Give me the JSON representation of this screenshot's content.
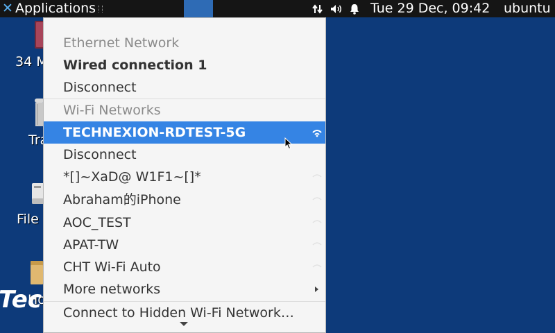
{
  "panel": {
    "applications_label": "Applications",
    "clock": "Tue 29 Dec, 09:42",
    "hostname": "ubuntu",
    "tray_icons": [
      "network-transfer-icon",
      "volume-icon",
      "notification-bell-icon"
    ]
  },
  "desktop": {
    "icons": [
      {
        "label": "34 M",
        "icon": "drive-icon"
      },
      {
        "label": "Tra",
        "icon": "trash-icon"
      },
      {
        "label": "File",
        "icon": "filesystem-icon"
      },
      {
        "label": "Ho",
        "icon": "home-folder-icon"
      }
    ],
    "watermark": "Tec"
  },
  "menu": {
    "ethernet_header": "Ethernet Network",
    "wired_connection": "Wired connection 1",
    "wired_disconnect": "Disconnect",
    "wifi_header": "Wi-Fi Networks",
    "active_network": "TECHNEXION-RDTEST-5G",
    "wifi_disconnect": "Disconnect",
    "networks": [
      {
        "ssid": "*[]~XaD@ W1F1~[]*",
        "signal": "weak"
      },
      {
        "ssid": "Abraham的iPhone",
        "signal": "weak"
      },
      {
        "ssid": "AOC_TEST",
        "signal": "weak"
      },
      {
        "ssid": "APAT-TW",
        "signal": "weak"
      },
      {
        "ssid": "CHT Wi-Fi Auto",
        "signal": "weak"
      }
    ],
    "more_networks": "More networks",
    "connect_hidden": "Connect to Hidden Wi-Fi Network…"
  },
  "colors": {
    "desktop_background": "#0d3a7a",
    "panel_background": "#151515",
    "selection": "#3584e4",
    "menu_background": "#f5f5f5"
  }
}
